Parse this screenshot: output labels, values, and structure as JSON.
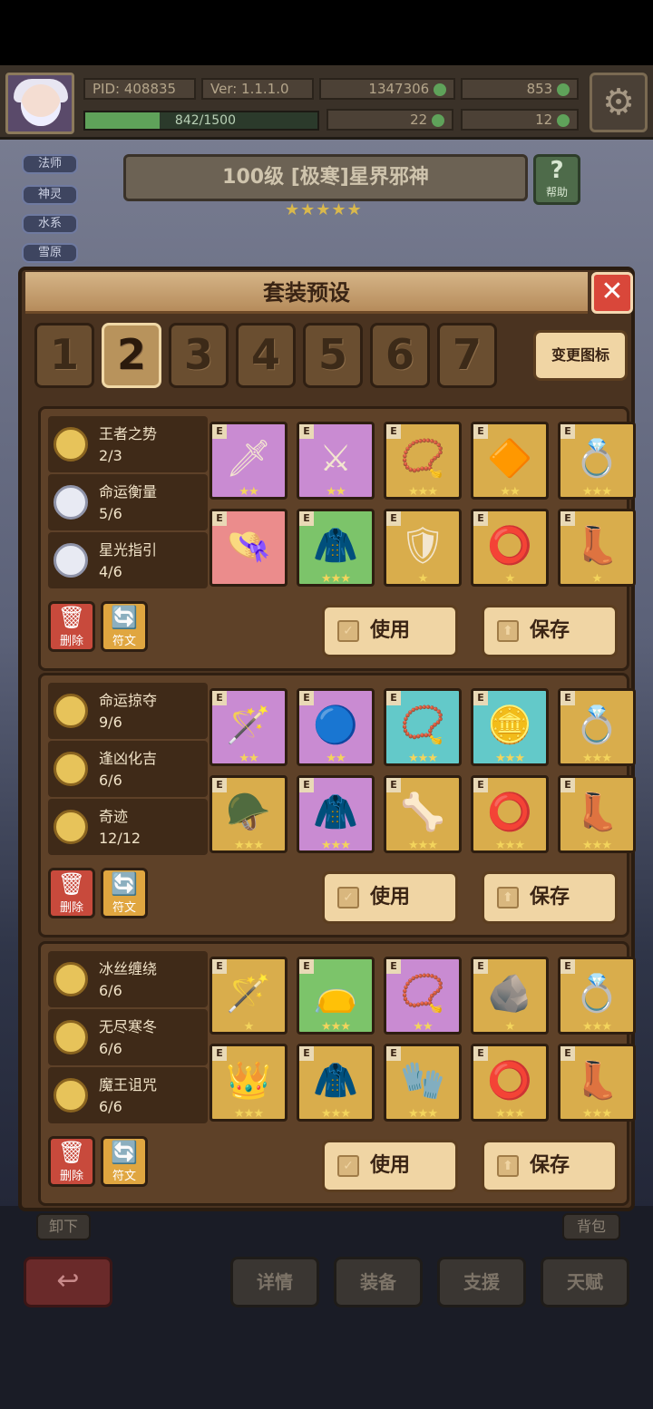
{
  "topbar": {
    "pid": "PID: 408835",
    "version": "Ver: 1.1.1.0",
    "gold": "1347306",
    "gems": "853",
    "xp": "842/1500",
    "clover": "22",
    "key": "12"
  },
  "tags": [
    "法师",
    "神灵",
    "水系",
    "雪原"
  ],
  "boss": {
    "title": "100级  [极寒]星界邪神",
    "stars": "★★★★★",
    "help": "帮助",
    "help_icon": "?"
  },
  "panel": {
    "title": "套装预设",
    "close": "✕",
    "slots": [
      "1",
      "2",
      "3",
      "4",
      "5",
      "6",
      "7"
    ],
    "active_slot": "2",
    "change_icon": "变更图标"
  },
  "presets": [
    {
      "sets": [
        {
          "name": "王者之势",
          "count": "2/3"
        },
        {
          "name": "命运衡量",
          "count": "5/6"
        },
        {
          "name": "星光指引",
          "count": "4/6"
        }
      ],
      "items": [
        {
          "color": "purple",
          "glyph": "🗡",
          "stars": "★★"
        },
        {
          "color": "purple",
          "glyph": "⚔",
          "stars": "★★"
        },
        {
          "color": "gold",
          "glyph": "📿",
          "stars": "★★★"
        },
        {
          "color": "gold",
          "glyph": "🔶",
          "stars": "★★"
        },
        {
          "color": "gold",
          "glyph": "💍",
          "stars": "★★★"
        },
        {
          "color": "pink",
          "glyph": "👒",
          "stars": ""
        },
        {
          "color": "green",
          "glyph": "🧥",
          "stars": "★★★"
        },
        {
          "color": "gold",
          "glyph": "🛡",
          "stars": "★"
        },
        {
          "color": "gold",
          "glyph": "⭕",
          "stars": "★"
        },
        {
          "color": "gold",
          "glyph": "👢",
          "stars": "★"
        }
      ],
      "delete": "删除",
      "rune": "符文",
      "use": "使用",
      "save": "保存"
    },
    {
      "sets": [
        {
          "name": "命运掠夺",
          "count": "9/6"
        },
        {
          "name": "逢凶化吉",
          "count": "6/6"
        },
        {
          "name": "奇迹",
          "count": "12/12"
        }
      ],
      "items": [
        {
          "color": "purple",
          "glyph": "🪄",
          "stars": "★★"
        },
        {
          "color": "purple",
          "glyph": "🔵",
          "stars": "★★"
        },
        {
          "color": "cyan",
          "glyph": "📿",
          "stars": "★★★"
        },
        {
          "color": "cyan",
          "glyph": "🪙",
          "stars": "★★★"
        },
        {
          "color": "gold",
          "glyph": "💍",
          "stars": "★★★"
        },
        {
          "color": "gold",
          "glyph": "🪖",
          "stars": "★★★"
        },
        {
          "color": "purple",
          "glyph": "🧥",
          "stars": "★★★"
        },
        {
          "color": "gold",
          "glyph": "🦴",
          "stars": "★★★"
        },
        {
          "color": "gold",
          "glyph": "⭕",
          "stars": "★★★"
        },
        {
          "color": "gold",
          "glyph": "👢",
          "stars": "★★★"
        }
      ],
      "delete": "删除",
      "rune": "符文",
      "use": "使用",
      "save": "保存"
    },
    {
      "sets": [
        {
          "name": "冰丝缠绕",
          "count": "6/6"
        },
        {
          "name": "无尽寒冬",
          "count": "6/6"
        },
        {
          "name": "魔王诅咒",
          "count": "6/6"
        }
      ],
      "items": [
        {
          "color": "gold",
          "glyph": "🪄",
          "stars": "★"
        },
        {
          "color": "green",
          "glyph": "👝",
          "stars": "★★★"
        },
        {
          "color": "purple",
          "glyph": "📿",
          "stars": "★★"
        },
        {
          "color": "gold",
          "glyph": "🪨",
          "stars": "★"
        },
        {
          "color": "gold",
          "glyph": "💍",
          "stars": "★★★"
        },
        {
          "color": "gold",
          "glyph": "👑",
          "stars": "★★★"
        },
        {
          "color": "gold",
          "glyph": "🧥",
          "stars": "★★★"
        },
        {
          "color": "gold",
          "glyph": "🧤",
          "stars": "★★★"
        },
        {
          "color": "gold",
          "glyph": "⭕",
          "stars": "★★★"
        },
        {
          "color": "gold",
          "glyph": "👢",
          "stars": "★★★"
        }
      ],
      "delete": "删除",
      "rune": "符文",
      "use": "使用",
      "save": "保存"
    }
  ],
  "bottom": {
    "unequip": "卸下",
    "bag": "背包",
    "back_icon": "↩",
    "nav": [
      "详情",
      "装备",
      "支援",
      "天赋"
    ]
  }
}
